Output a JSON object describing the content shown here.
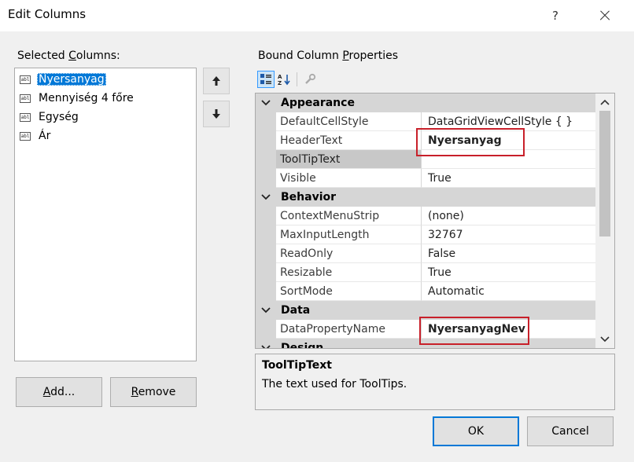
{
  "window": {
    "title": "Edit Columns",
    "help_label": "?"
  },
  "selected_columns": {
    "label_pre": "Selected ",
    "label_acc": "C",
    "label_post": "olumns:",
    "items": [
      {
        "label": "Nyersanyag",
        "selected": true
      },
      {
        "label": "Mennyiség 4 főre",
        "selected": false
      },
      {
        "label": "Egység",
        "selected": false
      },
      {
        "label": "Ár",
        "selected": false
      }
    ],
    "item_icon_text": "abl"
  },
  "move_buttons": {
    "up_glyph": "🡑",
    "down_glyph": "🡓"
  },
  "list_buttons": {
    "add_acc": "A",
    "add_post": "dd...",
    "remove_acc": "R",
    "remove_post": "emove"
  },
  "properties": {
    "label_pre": "Bound Column ",
    "label_acc": "P",
    "label_post": "roperties",
    "categories": [
      {
        "name": "Appearance",
        "rows": [
          {
            "name": "DefaultCellStyle",
            "value": "DataGridViewCellStyle { }"
          },
          {
            "name": "HeaderText",
            "value": "Nyersanyag"
          },
          {
            "name": "ToolTipText",
            "value": ""
          },
          {
            "name": "Visible",
            "value": "True"
          }
        ]
      },
      {
        "name": "Behavior",
        "rows": [
          {
            "name": "ContextMenuStrip",
            "value": "(none)"
          },
          {
            "name": "MaxInputLength",
            "value": "32767"
          },
          {
            "name": "ReadOnly",
            "value": "False"
          },
          {
            "name": "Resizable",
            "value": "True"
          },
          {
            "name": "SortMode",
            "value": "Automatic"
          }
        ]
      },
      {
        "name": "Data",
        "rows": [
          {
            "name": "DataPropertyName",
            "value": "NyersanyagNev"
          }
        ]
      },
      {
        "name": "Design",
        "rows": []
      }
    ],
    "description": {
      "title": "ToolTipText",
      "text": "The text used for ToolTips."
    }
  },
  "dialog_buttons": {
    "ok": "OK",
    "cancel": "Cancel"
  },
  "colors": {
    "selection": "#0078d7",
    "highlight_box": "#c8202a",
    "category_band": "#d6d6d6"
  }
}
